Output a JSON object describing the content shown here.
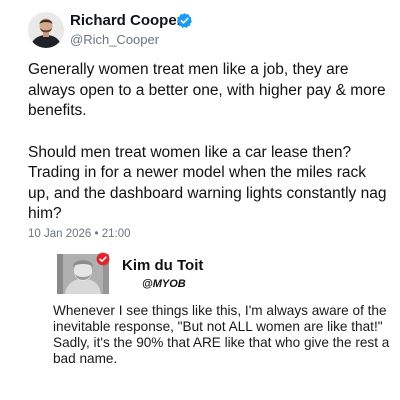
{
  "post": {
    "author": {
      "name": "Richard Cooper",
      "handle": "@Rich_Cooper",
      "verified": true,
      "verified_color": "#1d9bf0"
    },
    "paragraphs": [
      "Generally women treat men like a job, they are always open to a better one, with higher pay & more benefits.",
      "Should men treat women like a car lease then?  Trading in for a newer model when the miles rack up, and the dashboard warning lights constantly nag him?"
    ],
    "timestamp": "10 Jan 2026 • 21:00"
  },
  "embedded": {
    "author": {
      "name": "Kim du Toit",
      "handle": "@MYOB",
      "badge_icon": "red-check-badge-icon",
      "badge_color": "#e0262c"
    },
    "paragraphs": [
      "Whenever I see things like this, I'm always aware of the inevitable response, \"But not ALL women are like that!\"",
      "Sadly, it's the 90% that ARE like that who give the rest a bad name."
    ]
  }
}
